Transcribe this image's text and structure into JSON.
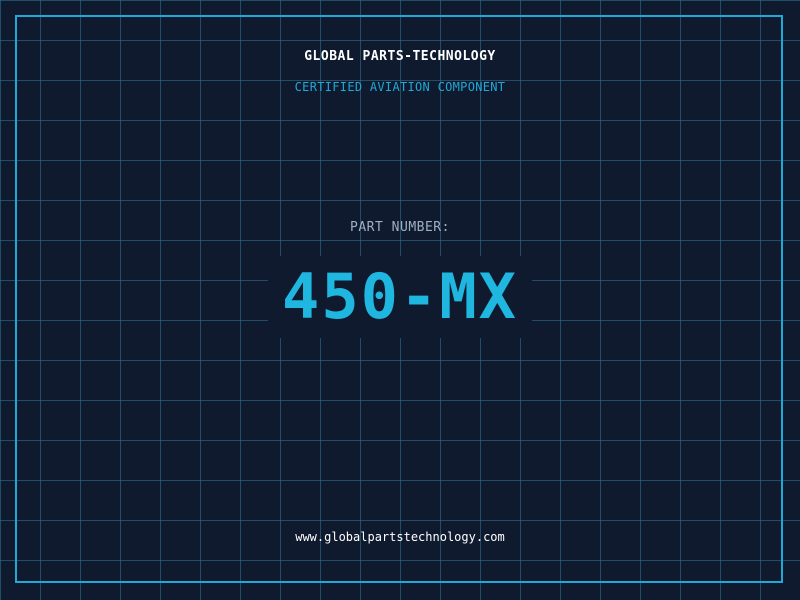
{
  "header": {
    "company_name": "GLOBAL PARTS-TECHNOLOGY",
    "tagline": "CERTIFIED AVIATION COMPONENT"
  },
  "part": {
    "label": "PART NUMBER:",
    "number": "450-MX"
  },
  "footer": {
    "website": "www.globalpartstechnology.com"
  },
  "colors": {
    "background": "#0f1a2e",
    "grid": "#2e7896",
    "accent": "#1fa8d8",
    "part_number": "#1fb6e0",
    "label": "#9fb0c4",
    "text": "#ffffff"
  }
}
